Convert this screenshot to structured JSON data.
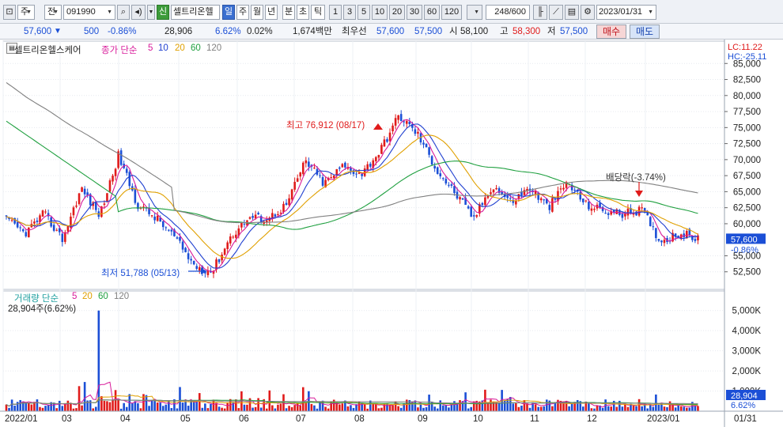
{
  "toolbar": {
    "gubun": "주",
    "jeon": "전",
    "code": "091990",
    "shin": "신",
    "name": "셀트리온헬",
    "periods": [
      "일",
      "주",
      "월",
      "년",
      "분",
      "초",
      "틱"
    ],
    "active_period": "일",
    "minute_units": [
      "1",
      "3",
      "5",
      "10",
      "20",
      "30",
      "60",
      "120"
    ],
    "count": "248/600",
    "date": "2023/01/31"
  },
  "info": {
    "price": "57,600",
    "arrow": "▼",
    "change": "500",
    "change_pct": "-0.86%",
    "volume": "28,906",
    "vol_pct": "6.62%",
    "turnover": "0.02%",
    "amount": "1,674백만",
    "best_label": "최우선",
    "ask": "57,600",
    "bid": "57,500",
    "open_label": "시",
    "open": "58,100",
    "high_label": "고",
    "high": "58,300",
    "low_label": "저",
    "low": "57,500",
    "buy": "매수",
    "sell": "매도"
  },
  "price_legend": {
    "name": "셀트리온헬스케어",
    "title": "종가 단순",
    "ma": [
      "5",
      "10",
      "20",
      "60",
      "120"
    ],
    "ma_colors": [
      "#d81b9a",
      "#2040d0",
      "#e0a000",
      "#20a040",
      "#808080"
    ]
  },
  "volume_legend": {
    "title": "거래량 단순",
    "ma": [
      "5",
      "20",
      "60",
      "120"
    ],
    "ma_colors": [
      "#d81b9a",
      "#e0a000",
      "#20a040",
      "#808080"
    ],
    "current": "28,904주(6.62%)"
  },
  "right_top": {
    "lc": "LC:11.22",
    "hc": "HC:-25.11"
  },
  "annotations": {
    "high": "최고 76,912 (08/17)",
    "low": "최저 51,788 (05/13)",
    "dividend": "배당락(-3.74%)"
  },
  "price_axis": [
    "85,000",
    "82,500",
    "80,000",
    "77,500",
    "75,000",
    "72,500",
    "70,000",
    "67,500",
    "65,000",
    "62,500",
    "60,000",
    "55,000",
    "52,500"
  ],
  "price_tag": {
    "price": "57,600",
    "pct": "-0.86%"
  },
  "volume_axis": [
    "5,000K",
    "4,000K",
    "3,000K",
    "2,000K",
    "1,000K"
  ],
  "volume_tag": {
    "value": "28,904",
    "pct": "6.62%"
  },
  "x_axis": [
    "2022/01",
    "03",
    "04",
    "05",
    "06",
    "07",
    "08",
    "09",
    "10",
    "11",
    "12",
    "2023/01",
    "01/31"
  ],
  "chart_data": {
    "type": "candlestick",
    "price_ylim": [
      50000,
      87500
    ],
    "volume_ylim": [
      0,
      5500
    ],
    "volume_unit": "K",
    "price_closes": [
      60600,
      58500,
      61600,
      57600,
      65500,
      61300,
      70700,
      63000,
      60900,
      57900,
      53600,
      52500,
      58000,
      61000,
      60800,
      63000,
      69900,
      66200,
      69000,
      67800,
      71400,
      76900,
      74000,
      68500,
      64800,
      60800,
      66000,
      63400,
      65600,
      62500,
      66500,
      63000,
      62000,
      61500,
      62200,
      57200,
      58600,
      57600
    ],
    "volume_peaks_k": [
      5000,
      1450,
      1200,
      1050,
      800,
      850,
      900,
      650,
      250,
      200,
      500,
      600,
      500,
      250
    ]
  }
}
